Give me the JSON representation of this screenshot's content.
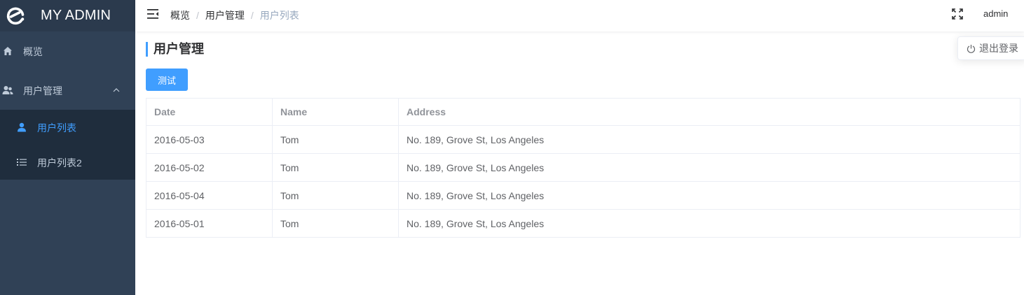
{
  "app": {
    "title": "MY ADMIN",
    "logo_icon": "element-logo-icon"
  },
  "sidebar": {
    "background": "#304156",
    "active_color": "#409eff",
    "items": [
      {
        "label": "概览",
        "icon": "home-icon"
      },
      {
        "label": "用户管理",
        "icon": "users-icon",
        "expanded": true
      }
    ],
    "subitems": [
      {
        "label": "用户列表",
        "icon": "user-icon",
        "active": true
      },
      {
        "label": "用户列表2",
        "icon": "list-icon",
        "active": false
      }
    ]
  },
  "header": {
    "breadcrumb": [
      "概览",
      "用户管理",
      "用户列表"
    ],
    "user": "admin",
    "dropdown": {
      "logout_label": "退出登录",
      "icon": "power-icon"
    }
  },
  "main": {
    "title": "用户管理",
    "test_button": "测试",
    "table": {
      "columns": [
        "Date",
        "Name",
        "Address"
      ],
      "rows": [
        [
          "2016-05-03",
          "Tom",
          "No. 189, Grove St, Los Angeles"
        ],
        [
          "2016-05-02",
          "Tom",
          "No. 189, Grove St, Los Angeles"
        ],
        [
          "2016-05-04",
          "Tom",
          "No. 189, Grove St, Los Angeles"
        ],
        [
          "2016-05-01",
          "Tom",
          "No. 189, Grove St, Los Angeles"
        ]
      ]
    }
  }
}
